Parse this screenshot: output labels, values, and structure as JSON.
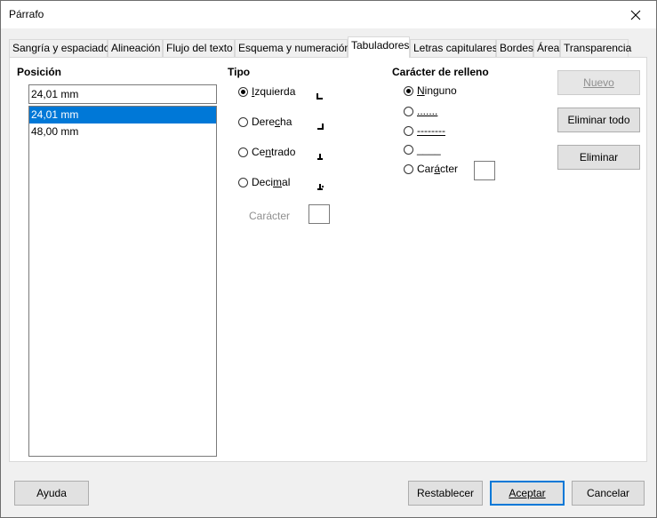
{
  "window": {
    "title": "Párrafo"
  },
  "tabs": [
    {
      "label": "Sangría y espaciado"
    },
    {
      "label": "Alineación"
    },
    {
      "label": "Flujo del texto"
    },
    {
      "label": "Esquema y numeración"
    },
    {
      "label": "Tabuladores",
      "active": true
    },
    {
      "label": "Letras capitulares"
    },
    {
      "label": "Bordes"
    },
    {
      "label": "Área"
    },
    {
      "label": "Transparencia"
    }
  ],
  "position": {
    "heading": "Posición",
    "input_value": "24,01 mm",
    "items": [
      "24,01 mm",
      "48,00 mm"
    ],
    "selected_index": 0
  },
  "type": {
    "heading": "Tipo",
    "options": [
      {
        "label": "Izquierda",
        "checked": true,
        "accel": "I",
        "rest": "zquierda"
      },
      {
        "label": "Derecha",
        "pre": "Dere",
        "accel": "c",
        "rest": "ha"
      },
      {
        "label": "Centrado",
        "pre": "Ce",
        "accel": "n",
        "rest": "trado"
      },
      {
        "label": "Decimal",
        "pre": "Deci",
        "accel": "m",
        "rest": "al"
      }
    ],
    "character_label": "Carácter"
  },
  "fill": {
    "heading": "Carácter de relleno",
    "options": [
      {
        "label": "Ninguno",
        "checked": true,
        "accel": "N",
        "rest": "inguno"
      },
      {
        "label": "......."
      },
      {
        "label": "--------"
      },
      {
        "label": "____"
      },
      {
        "label": "Carácter",
        "pre": "Car",
        "accel": "á",
        "rest": "cter"
      }
    ]
  },
  "side_buttons": {
    "new": "Nuevo",
    "delete_all": "Eliminar todo",
    "delete": "Eliminar"
  },
  "footer": {
    "help": "Ayuda",
    "reset": "Restablecer",
    "ok": "Aceptar",
    "cancel": "Cancelar"
  },
  "colors": {
    "selection": "#0078d7",
    "default_button_border": "#0078d7"
  }
}
